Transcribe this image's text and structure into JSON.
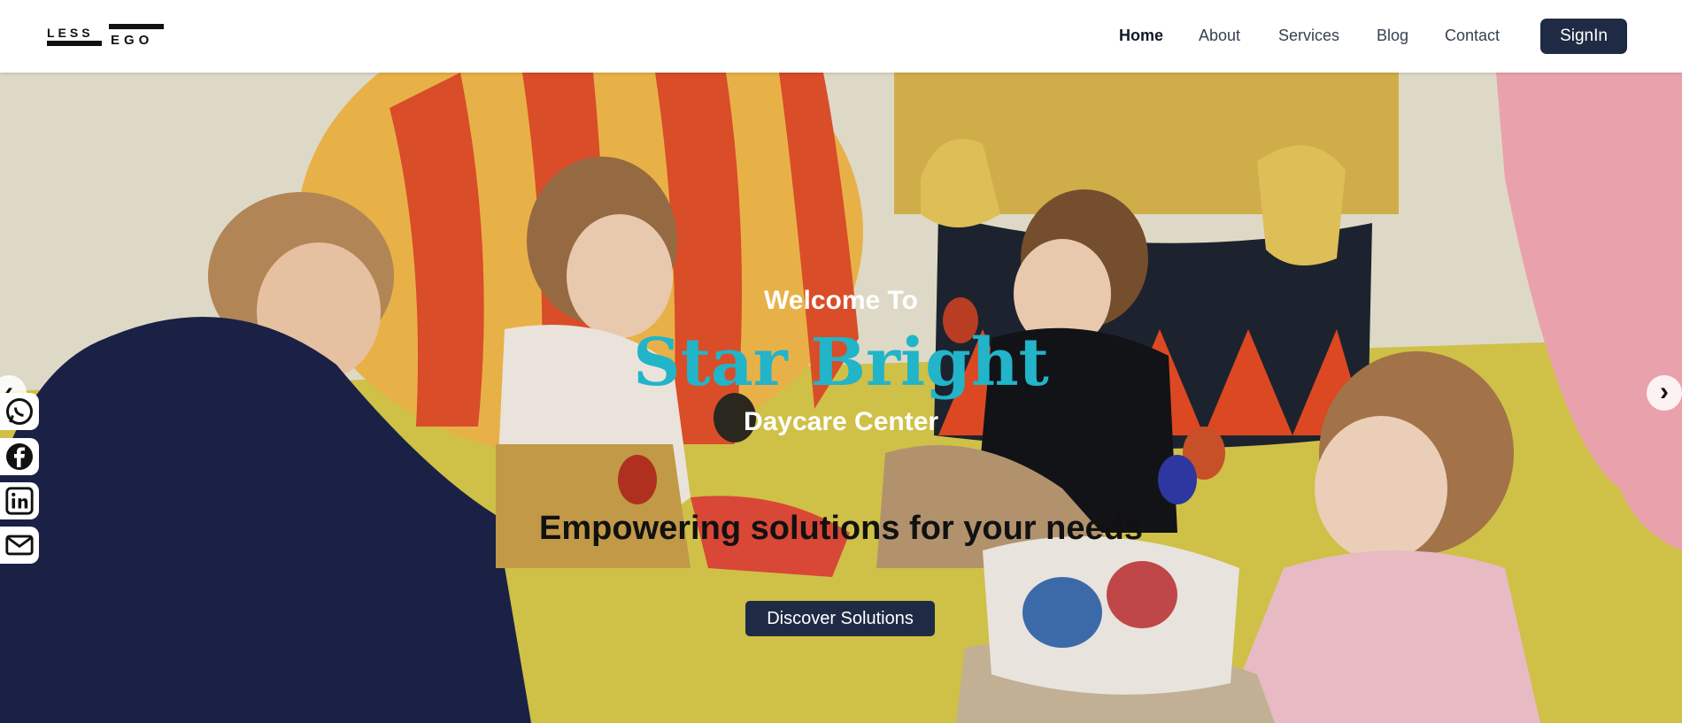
{
  "header": {
    "logo": {
      "line1": "LESS",
      "line2": "EGO"
    },
    "nav": [
      {
        "label": "Home",
        "active": true
      },
      {
        "label": "About"
      },
      {
        "label": "Services"
      },
      {
        "label": "Blog"
      },
      {
        "label": "Contact"
      }
    ],
    "signin_label": "SignIn"
  },
  "hero": {
    "welcome": "Welcome To",
    "brand": "Star Bright",
    "subbrand": "Daycare Center",
    "tagline": "Empowering solutions for your needs",
    "cta_label": "Discover Solutions",
    "brand_color": "#22b4c9",
    "button_color": "#1f2b45"
  },
  "social": [
    "whatsapp-icon",
    "facebook-icon",
    "linkedin-icon",
    "mail-icon"
  ],
  "carousel": {
    "prev_icon": "chevron-left-icon",
    "next_icon": "chevron-right-icon"
  }
}
